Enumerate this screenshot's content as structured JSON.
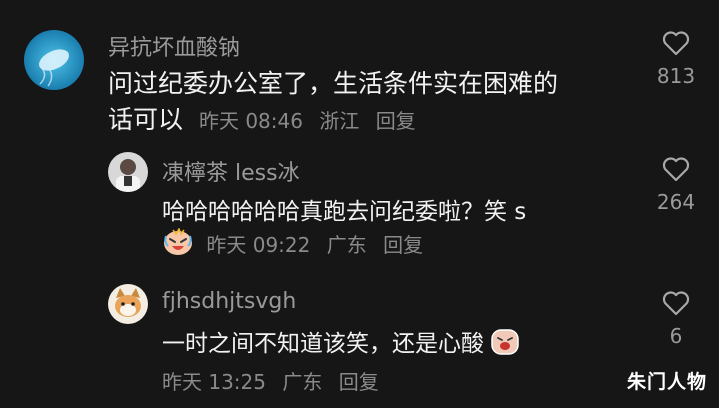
{
  "comments": [
    {
      "username": "异抗坏血酸钠",
      "text_line1": "问过纪委办公室了，生活条件实在困难的",
      "text_line2": "话可以",
      "time": "昨天 08:46",
      "location": "浙江",
      "reply_label": "回复",
      "likes": "813",
      "avatar_icon": "jellyfish-avatar"
    },
    {
      "username": "凍檸茶 less冰",
      "text_line1": "哈哈哈哈哈哈真跑去问纪委啦？笑 s",
      "time": "昨天 09:22",
      "location": "广东",
      "reply_label": "回复",
      "likes": "264",
      "avatar_icon": "person-avatar",
      "emoji_icon": "laughing-crying-emoji"
    },
    {
      "username": "fjhsdhjtsvgh",
      "text_line1": "一时之间不知道该笑，还是心酸",
      "time": "昨天 13:25",
      "location": "广东",
      "reply_label": "回复",
      "likes": "6",
      "avatar_icon": "cat-avatar",
      "emoji_icon": "crying-emoji"
    }
  ],
  "watermark": "朱门人物",
  "colors": {
    "background": "#161616",
    "username": "#9a9a9a",
    "text": "#f2f2f2",
    "meta": "#8a8a8a"
  }
}
